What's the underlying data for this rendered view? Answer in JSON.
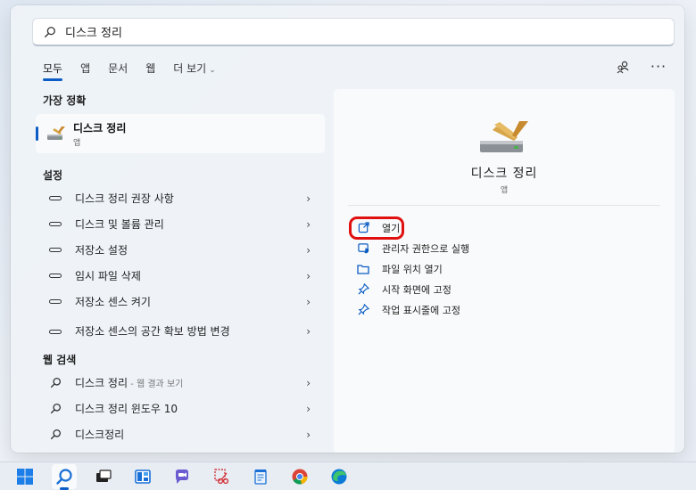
{
  "search": {
    "value": "디스크 정리"
  },
  "tabs": [
    {
      "label": "모두",
      "active": true
    },
    {
      "label": "앱"
    },
    {
      "label": "문서"
    },
    {
      "label": "웹"
    },
    {
      "label": "더 보기"
    }
  ],
  "best_match": {
    "heading": "가장 정확",
    "title": "디스크 정리",
    "subtitle": "앱"
  },
  "settings": {
    "heading": "설정",
    "items": [
      {
        "label": "디스크 정리 권장 사항"
      },
      {
        "label": "디스크 및 볼륨 관리"
      },
      {
        "label": "저장소 설정"
      },
      {
        "label": "임시 파일 삭제"
      },
      {
        "label": "저장소 센스 켜기"
      },
      {
        "label": "저장소 센스의 공간 확보 방법 변경"
      }
    ]
  },
  "web": {
    "heading": "웹 검색",
    "items": [
      {
        "label": "디스크 정리",
        "suffix": " - 웹 결과 보기"
      },
      {
        "label": "디스크 정리 윈도우 10",
        "suffix": ""
      },
      {
        "label": "디스크정리",
        "suffix": ""
      }
    ]
  },
  "detail": {
    "title": "디스크 정리",
    "subtitle": "앱",
    "actions": [
      {
        "label": "열기",
        "icon": "open-external-icon"
      },
      {
        "label": "관리자 권한으로 실행",
        "icon": "admin-shield-icon"
      },
      {
        "label": "파일 위치 열기",
        "icon": "folder-icon"
      },
      {
        "label": "시작 화면에 고정",
        "icon": "pin-icon"
      },
      {
        "label": "작업 표시줄에 고정",
        "icon": "pin-icon"
      }
    ]
  },
  "colors": {
    "accent": "#0b5cc4",
    "highlight": "#e01010"
  },
  "taskbar": [
    {
      "icon": "windows-start-icon"
    },
    {
      "icon": "search-icon"
    },
    {
      "icon": "task-view-icon"
    },
    {
      "icon": "widgets-icon"
    },
    {
      "icon": "chat-icon"
    },
    {
      "icon": "snipping-tool-icon"
    },
    {
      "icon": "notepad-icon"
    },
    {
      "icon": "chrome-icon"
    },
    {
      "icon": "edge-icon"
    }
  ]
}
